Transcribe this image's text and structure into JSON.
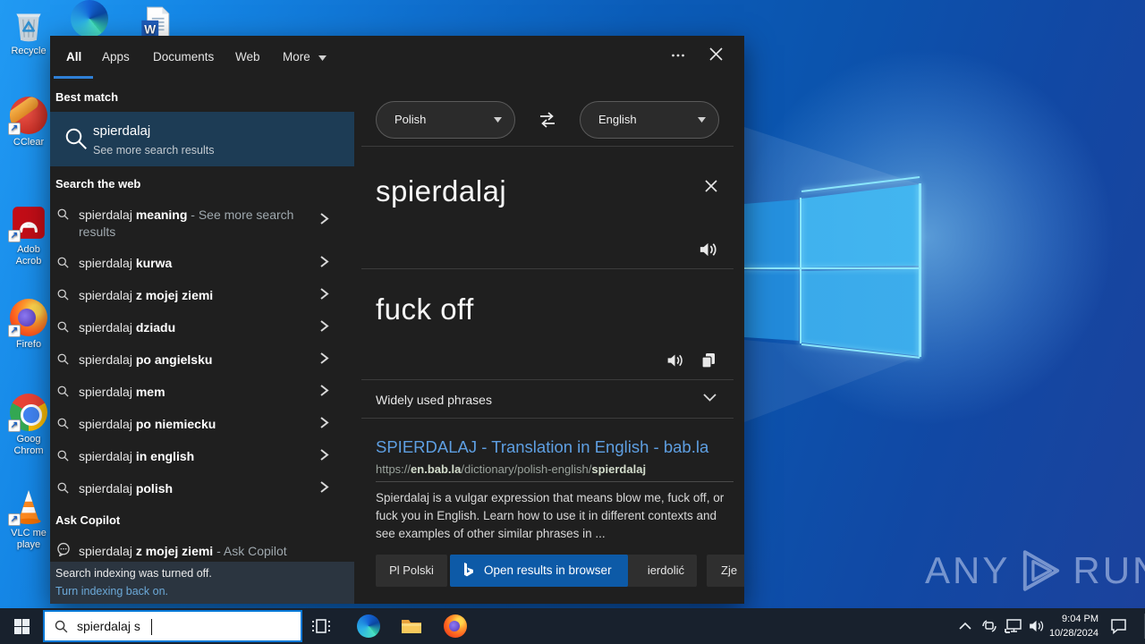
{
  "colors": {
    "accent": "#0078d7",
    "panel_bg": "#1f1f1f",
    "highlight_row": "#1d3c55",
    "link_blue": "#5e9fe2",
    "button_blue": "#0d5aa7",
    "banner_link": "#6ca9d8",
    "taskbar_bg": "#18212d"
  },
  "desktop": {
    "icons": [
      {
        "label": "Recycle"
      },
      {
        "label": "CClear"
      },
      {
        "label": "Adob Acrob"
      },
      {
        "label": "Firefo"
      },
      {
        "label": "Goog Chrom"
      },
      {
        "label": "VLC me playe"
      }
    ],
    "top_icons": [
      {
        "name": "Microsoft Edge"
      },
      {
        "name": "Word document"
      }
    ]
  },
  "window": {
    "tabs": [
      {
        "label": "All"
      },
      {
        "label": "Apps"
      },
      {
        "label": "Documents"
      },
      {
        "label": "Web"
      },
      {
        "label": "More"
      }
    ],
    "best_match": {
      "header": "Best match",
      "title": "spierdalaj",
      "subtitle": "See more search results"
    },
    "web_header": "Search the web",
    "suggestions": [
      {
        "prefix": "spierdalaj ",
        "bold": "meaning",
        "suffix": " - See more search results"
      },
      {
        "prefix": "spierdalaj ",
        "bold": "kurwa"
      },
      {
        "prefix": "spierdalaj ",
        "bold": "z mojej ziemi"
      },
      {
        "prefix": "spierdalaj ",
        "bold": "dziadu"
      },
      {
        "prefix": "spierdalaj ",
        "bold": "po angielsku"
      },
      {
        "prefix": "spierdalaj ",
        "bold": "mem"
      },
      {
        "prefix": "spierdalaj ",
        "bold": "po niemiecku"
      },
      {
        "prefix": "spierdalaj ",
        "bold": "in english"
      },
      {
        "prefix": "spierdalaj ",
        "bold": "polish"
      }
    ],
    "copilot": {
      "header": "Ask Copilot",
      "prefix": "spierdalaj ",
      "bold": "z mojej ziemi",
      "suffix": " - Ask Copilot"
    },
    "banner": {
      "line1": "Search indexing was turned off.",
      "link": "Turn indexing back on."
    }
  },
  "translator": {
    "source_language": "Polish",
    "target_language": "English",
    "input_text": "spierdalaj",
    "output_text": "fuck off",
    "phrases_label": "Widely used phrases"
  },
  "result": {
    "title": "SPIERDALAJ - Translation in English - bab.la",
    "url_pre": "https://",
    "url_bold1": "en.bab.la",
    "url_mid": "/dictionary/polish-english/",
    "url_bold2": "spierdalaj",
    "description": "Spierdalaj is a vulgar expression that means blow me, fuck off, or fuck you in English. Learn how to use it in different contexts and see examples of other similar phrases in ..."
  },
  "footer_buttons": {
    "b1": "Pl Polski",
    "b2": "Open results in browser",
    "b3": "ierdolić",
    "b4": "Zje"
  },
  "taskbar": {
    "search_value": "spierdalaj s"
  },
  "tray": {
    "time": "9:04 PM",
    "date": "10/28/2024"
  },
  "watermark": {
    "left": "ANY",
    "right": "RUN"
  }
}
